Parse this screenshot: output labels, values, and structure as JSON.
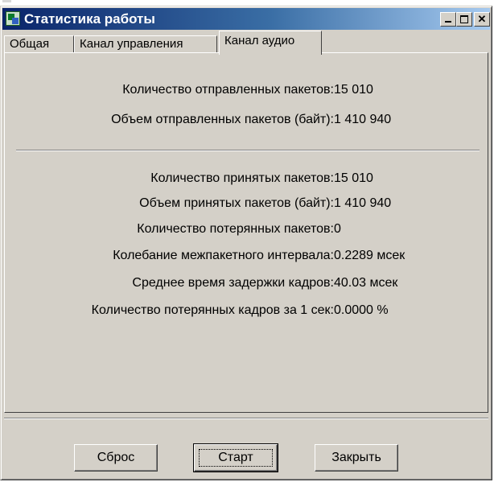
{
  "window": {
    "title": "Статистика работы",
    "icons": {
      "app": "app-stats-icon",
      "minimize": "minimize-icon",
      "maximize": "maximize-icon",
      "close": "close-icon"
    }
  },
  "tabs": [
    {
      "label": "Общая",
      "active": false
    },
    {
      "label": "Канал управления",
      "active": false
    },
    {
      "label": "Канал аудио",
      "active": true
    }
  ],
  "sent": [
    {
      "label": "Количество отправленных пакетов:",
      "value": "15 010"
    },
    {
      "label": "Объем  отправленных пакетов (байт):",
      "value": "1 410 940"
    }
  ],
  "received": [
    {
      "label": "Количество принятых пакетов:",
      "value": "15 010"
    },
    {
      "label": "Объем  принятых пакетов (байт):",
      "value": "1 410 940"
    },
    {
      "label": "Количество потерянных пакетов:",
      "value": "0"
    },
    {
      "label": "Колебание межпакетного интервала:",
      "value": "0.2289 мсек"
    },
    {
      "label": "Среднее время задержки кадров:",
      "value": "40.03 мсек"
    },
    {
      "label": "Количество потерянных кадров за 1 сек:",
      "value": "0.0000 %"
    }
  ],
  "buttons": {
    "reset": "Сброс",
    "start": "Старт",
    "close": "Закрыть"
  },
  "colors": {
    "titlebar_start": "#0a246a",
    "titlebar_end": "#a6caf0",
    "face": "#d4d0c8"
  }
}
